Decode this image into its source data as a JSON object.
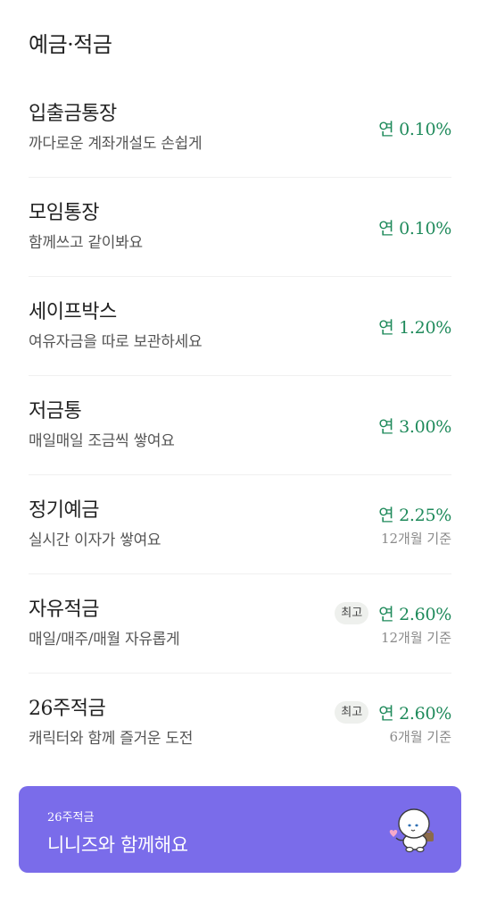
{
  "section": {
    "title": "예금·적금"
  },
  "products": [
    {
      "name": "입출금통장",
      "desc": "까다로운 계좌개설도 손쉽게",
      "rate": "연 0.10%"
    },
    {
      "name": "모임통장",
      "desc": "함께쓰고 같이봐요",
      "rate": "연 0.10%"
    },
    {
      "name": "세이프박스",
      "desc": "여유자금을 따로 보관하세요",
      "rate": "연 1.20%"
    },
    {
      "name": "저금통",
      "desc": "매일매일 조금씩 쌓여요",
      "rate": "연 3.00%"
    },
    {
      "name": "정기예금",
      "desc": "실시간 이자가 쌓여요",
      "rate": "연 2.25%",
      "note": "12개월 기준"
    },
    {
      "name": "자유적금",
      "desc": "매일/매주/매월 자유롭게",
      "rate": "연 2.60%",
      "note": "12개월 기준",
      "badge": "최고"
    },
    {
      "name": "26주적금",
      "desc": "캐릭터와 함께 즐거운 도전",
      "rate": "연 2.60%",
      "note": "6개월 기준",
      "badge": "최고"
    }
  ],
  "banner": {
    "subtitle": "26주적금",
    "title": "니니즈와 함께해요",
    "icon": "mascot-character-icon",
    "color": "#7a6cea"
  },
  "colors": {
    "rate": "#1f8a5b",
    "note": "#8a8a8a",
    "badge_bg": "#eef0ed"
  }
}
